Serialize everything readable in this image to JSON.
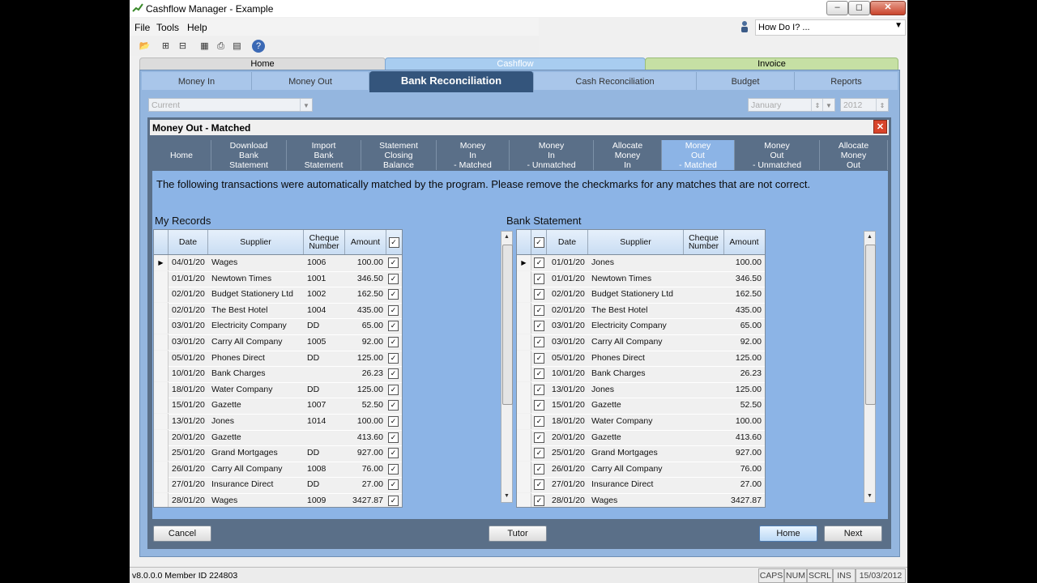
{
  "window": {
    "title": "Cashflow Manager - Example"
  },
  "menu": {
    "file": "File",
    "tools": "Tools",
    "help": "Help"
  },
  "howdoi": {
    "text": "How Do I? ..."
  },
  "main_tabs": [
    {
      "label": "Home"
    },
    {
      "label": "Cashflow"
    },
    {
      "label": "Invoice"
    }
  ],
  "sub_tabs": [
    {
      "label": "Money In"
    },
    {
      "label": "Money Out"
    },
    {
      "label": "Bank Reconciliation"
    },
    {
      "label": "Cash Reconciliation"
    },
    {
      "label": "Budget"
    },
    {
      "label": "Reports"
    }
  ],
  "filters": {
    "period": "Current",
    "month": "January",
    "year": "2012"
  },
  "dialog": {
    "title": "Money Out - Matched",
    "steps": [
      {
        "label": "Home"
      },
      {
        "label": "Download\nBank\nStatement"
      },
      {
        "label": "Import\nBank\nStatement"
      },
      {
        "label": "Statement\nClosing\nBalance"
      },
      {
        "label": "Money\nIn\n- Matched"
      },
      {
        "label": "Money\nIn\n- Unmatched"
      },
      {
        "label": "Allocate\nMoney\nIn"
      },
      {
        "label": "Money\nOut\n- Matched"
      },
      {
        "label": "Money\nOut\n- Unmatched"
      },
      {
        "label": "Allocate\nMoney\nOut"
      }
    ],
    "message": "The following transactions were automatically matched by the program. Please remove the checkmarks for any matches that are not correct.",
    "my_records": {
      "title": "My Records",
      "headers": {
        "date": "Date",
        "supplier": "Supplier",
        "cheque": "Cheque\nNumber",
        "amount": "Amount"
      },
      "rows": [
        {
          "date": "04/01/20",
          "supplier": "Wages",
          "cheque": "1006",
          "amount": "100.00"
        },
        {
          "date": "01/01/20",
          "supplier": "Newtown Times",
          "cheque": "1001",
          "amount": "346.50"
        },
        {
          "date": "02/01/20",
          "supplier": "Budget Stationery Ltd",
          "cheque": "1002",
          "amount": "162.50"
        },
        {
          "date": "02/01/20",
          "supplier": "The Best Hotel",
          "cheque": "1004",
          "amount": "435.00"
        },
        {
          "date": "03/01/20",
          "supplier": "Electricity Company",
          "cheque": "DD",
          "amount": "65.00"
        },
        {
          "date": "03/01/20",
          "supplier": "Carry All Company",
          "cheque": "1005",
          "amount": "92.00"
        },
        {
          "date": "05/01/20",
          "supplier": "Phones Direct",
          "cheque": "DD",
          "amount": "125.00"
        },
        {
          "date": "10/01/20",
          "supplier": "Bank Charges",
          "cheque": "",
          "amount": "26.23"
        },
        {
          "date": "18/01/20",
          "supplier": "Water Company",
          "cheque": "DD",
          "amount": "125.00"
        },
        {
          "date": "15/01/20",
          "supplier": "Gazette",
          "cheque": "1007",
          "amount": "52.50"
        },
        {
          "date": "13/01/20",
          "supplier": "Jones",
          "cheque": "1014",
          "amount": "100.00"
        },
        {
          "date": "20/01/20",
          "supplier": "Gazette",
          "cheque": "",
          "amount": "413.60"
        },
        {
          "date": "25/01/20",
          "supplier": "Grand Mortgages",
          "cheque": "DD",
          "amount": "927.00"
        },
        {
          "date": "26/01/20",
          "supplier": "Carry All Company",
          "cheque": "1008",
          "amount": "76.00"
        },
        {
          "date": "27/01/20",
          "supplier": "Insurance Direct",
          "cheque": "DD",
          "amount": "27.00"
        },
        {
          "date": "28/01/20",
          "supplier": "Wages",
          "cheque": "1009",
          "amount": "3427.87"
        }
      ]
    },
    "bank_statement": {
      "title": "Bank Statement",
      "headers": {
        "date": "Date",
        "supplier": "Supplier",
        "cheque": "Cheque\nNumber",
        "amount": "Amount"
      },
      "rows": [
        {
          "date": "01/01/20",
          "supplier": "Jones",
          "cheque": "",
          "amount": "100.00"
        },
        {
          "date": "01/01/20",
          "supplier": "Newtown Times",
          "cheque": "",
          "amount": "346.50"
        },
        {
          "date": "02/01/20",
          "supplier": "Budget Stationery Ltd",
          "cheque": "",
          "amount": "162.50"
        },
        {
          "date": "02/01/20",
          "supplier": "The Best Hotel",
          "cheque": "",
          "amount": "435.00"
        },
        {
          "date": "03/01/20",
          "supplier": "Electricity Company",
          "cheque": "",
          "amount": "65.00"
        },
        {
          "date": "03/01/20",
          "supplier": "Carry All Company",
          "cheque": "",
          "amount": "92.00"
        },
        {
          "date": "05/01/20",
          "supplier": "Phones Direct",
          "cheque": "",
          "amount": "125.00"
        },
        {
          "date": "10/01/20",
          "supplier": "Bank Charges",
          "cheque": "",
          "amount": "26.23"
        },
        {
          "date": "13/01/20",
          "supplier": "Jones",
          "cheque": "",
          "amount": "125.00"
        },
        {
          "date": "15/01/20",
          "supplier": "Gazette",
          "cheque": "",
          "amount": "52.50"
        },
        {
          "date": "18/01/20",
          "supplier": "Water Company",
          "cheque": "",
          "amount": "100.00"
        },
        {
          "date": "20/01/20",
          "supplier": "Gazette",
          "cheque": "",
          "amount": "413.60"
        },
        {
          "date": "25/01/20",
          "supplier": "Grand Mortgages",
          "cheque": "",
          "amount": "927.00"
        },
        {
          "date": "26/01/20",
          "supplier": "Carry All Company",
          "cheque": "",
          "amount": "76.00"
        },
        {
          "date": "27/01/20",
          "supplier": "Insurance Direct",
          "cheque": "",
          "amount": "27.00"
        },
        {
          "date": "28/01/20",
          "supplier": "Wages",
          "cheque": "",
          "amount": "3427.87"
        }
      ]
    },
    "buttons": {
      "cancel": "Cancel",
      "tutor": "Tutor",
      "home": "Home",
      "next": "Next"
    }
  },
  "status": {
    "version": "v8.0.0.0 Member ID 224803",
    "caps": "CAPS",
    "num": "NUM",
    "scrl": "SCRL",
    "ins": "INS",
    "date": "15/03/2012"
  },
  "colors": {
    "panel": "#94b6df",
    "active_tab": "#34557c",
    "content": "#8cb4e6",
    "cashflow_tab": "#a8cdf0",
    "invoice_tab": "#c6e0a4"
  }
}
